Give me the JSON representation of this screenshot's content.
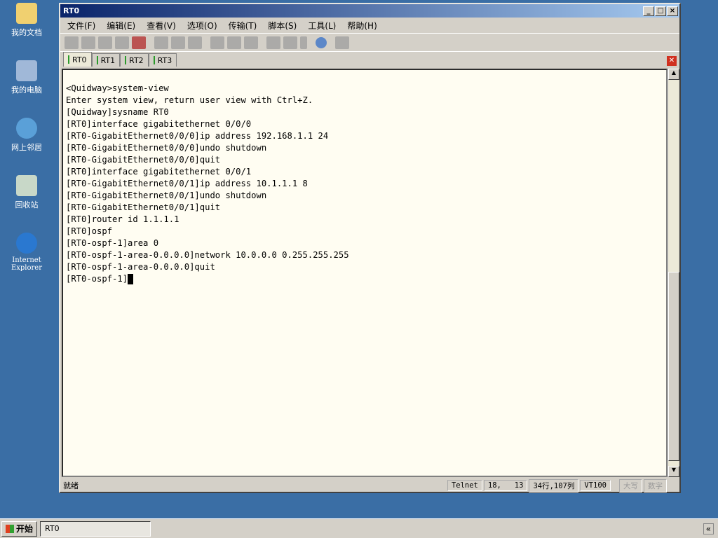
{
  "desktop": [
    "我的文档",
    "我的电脑",
    "网上邻居",
    "回收站",
    "Internet Explorer"
  ],
  "window": {
    "title": "RT0"
  },
  "menu": [
    "文件(F)",
    "编辑(E)",
    "查看(V)",
    "选项(O)",
    "传输(T)",
    "脚本(S)",
    "工具(L)",
    "帮助(H)"
  ],
  "tabs": [
    "RT0",
    "RT1",
    "RT2",
    "RT3"
  ],
  "terminal": [
    "<Quidway>system-view",
    "Enter system view, return user view with Ctrl+Z.",
    "[Quidway]sysname RT0",
    "[RT0]interface gigabitethernet 0/0/0",
    "[RT0-GigabitEthernet0/0/0]ip address 192.168.1.1 24",
    "[RT0-GigabitEthernet0/0/0]undo shutdown",
    "[RT0-GigabitEthernet0/0/0]quit",
    "[RT0]interface gigabitethernet 0/0/1",
    "[RT0-GigabitEthernet0/0/1]ip address 10.1.1.1 8",
    "[RT0-GigabitEthernet0/0/1]undo shutdown",
    "[RT0-GigabitEthernet0/0/1]quit",
    "[RT0]router id 1.1.1.1",
    "[RT0]ospf",
    "[RT0-ospf-1]area 0",
    "[RT0-ospf-1-area-0.0.0.0]network 10.0.0.0 0.255.255.255",
    "[RT0-ospf-1-area-0.0.0.0]quit",
    "[RT0-ospf-1]"
  ],
  "status": {
    "ready": "就绪",
    "protocol": "Telnet",
    "pos": "18,   13",
    "size": "34行,107列",
    "emu": "VT100",
    "caps": "大写",
    "num": "数字"
  },
  "taskbar": {
    "start": "开始",
    "item": "RT0",
    "chevron": "«"
  }
}
